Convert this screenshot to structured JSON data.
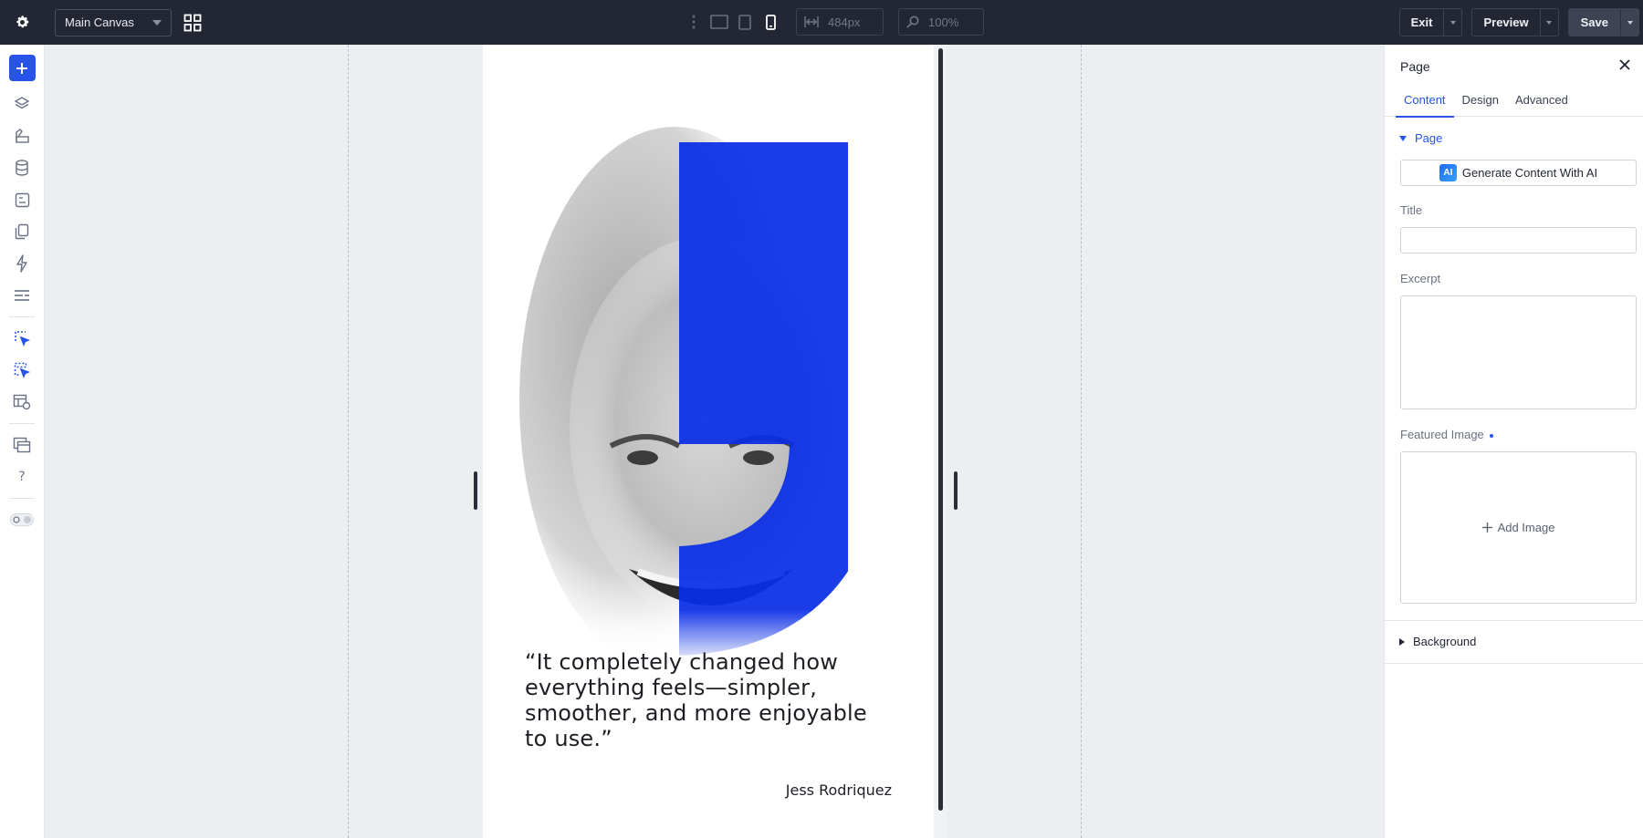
{
  "topbar": {
    "canvas_select": "Main Canvas",
    "width_value": "484px",
    "zoom_value": "100%",
    "exit_label": "Exit",
    "preview_label": "Preview",
    "save_label": "Save"
  },
  "canvas": {
    "quote": "“It completely changed how everything feels—simpler, smoother, and more enjoyable to use.”",
    "author": "Jess Rodriquez",
    "accent_color": "#0a2ee6"
  },
  "panel": {
    "title": "Page",
    "tabs": [
      {
        "label": "Content",
        "active": true
      },
      {
        "label": "Design",
        "active": false
      },
      {
        "label": "Advanced",
        "active": false
      }
    ],
    "section_page": "Page",
    "ai_badge": "AI",
    "ai_button": "Generate Content With AI",
    "title_label": "Title",
    "title_value": "",
    "excerpt_label": "Excerpt",
    "excerpt_value": "",
    "featured_image_label": "Featured Image",
    "add_image_label": "Add Image",
    "section_background": "Background"
  },
  "rail": {
    "icons": [
      "add-icon",
      "layers-icon",
      "palette-icon",
      "database-icon",
      "form-icon",
      "pages-icon",
      "lightning-icon",
      "list-icon",
      "cursor-select-icon",
      "cursor-multi-icon",
      "templates-icon",
      "windows-icon",
      "help-icon",
      "theme-toggle-icon"
    ]
  }
}
